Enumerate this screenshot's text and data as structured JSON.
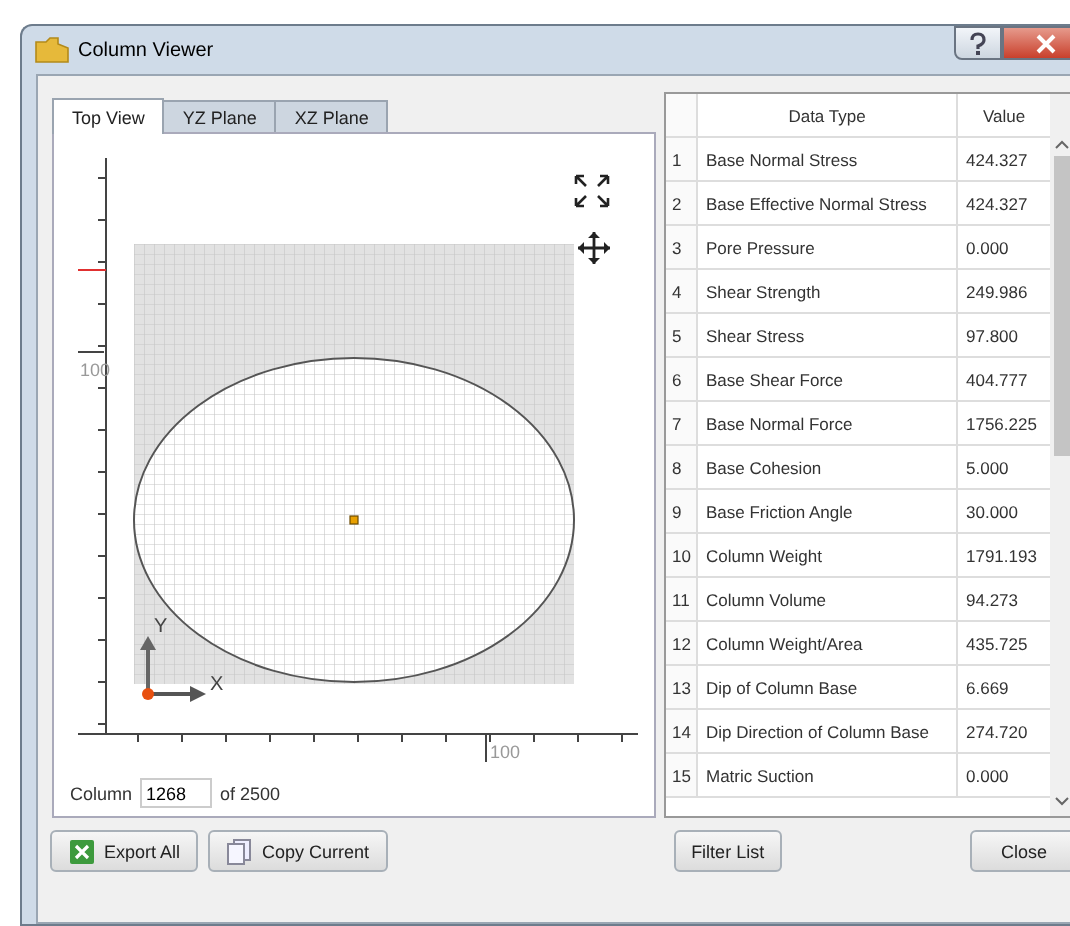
{
  "window": {
    "title": "Column Viewer"
  },
  "tabs": [
    {
      "label": "Top View",
      "selected": true
    },
    {
      "label": "YZ Plane",
      "selected": false
    },
    {
      "label": "XZ Plane",
      "selected": false
    }
  ],
  "view": {
    "left_ruler_label": "100",
    "bottom_ruler_label": "100",
    "y_axis": "Y",
    "x_axis": "X"
  },
  "column": {
    "label": "Column",
    "value": "1268",
    "total": "of 2500"
  },
  "table": {
    "columns": [
      "Data Type",
      "Value"
    ],
    "rows": [
      {
        "index": "1",
        "type": "Base Normal Stress",
        "value": "424.327"
      },
      {
        "index": "2",
        "type": "Base Effective Normal Stress",
        "value": "424.327"
      },
      {
        "index": "3",
        "type": "Pore Pressure",
        "value": "0.000"
      },
      {
        "index": "4",
        "type": "Shear Strength",
        "value": "249.986"
      },
      {
        "index": "5",
        "type": "Shear Stress",
        "value": "97.800"
      },
      {
        "index": "6",
        "type": "Base Shear Force",
        "value": "404.777"
      },
      {
        "index": "7",
        "type": "Base Normal Force",
        "value": "1756.225"
      },
      {
        "index": "8",
        "type": "Base Cohesion",
        "value": "5.000"
      },
      {
        "index": "9",
        "type": "Base Friction Angle",
        "value": "30.000"
      },
      {
        "index": "10",
        "type": "Column Weight",
        "value": "1791.193"
      },
      {
        "index": "11",
        "type": "Column Volume",
        "value": "94.273"
      },
      {
        "index": "12",
        "type": "Column Weight/Area",
        "value": "435.725"
      },
      {
        "index": "13",
        "type": "Dip of Column Base",
        "value": "6.669"
      },
      {
        "index": "14",
        "type": "Dip Direction of Column Base",
        "value": "274.720"
      },
      {
        "index": "15",
        "type": "Matric Suction",
        "value": "0.000"
      }
    ]
  },
  "buttons": {
    "export": "Export All",
    "copy": "Copy Current",
    "filter": "Filter List",
    "close": "Close"
  }
}
